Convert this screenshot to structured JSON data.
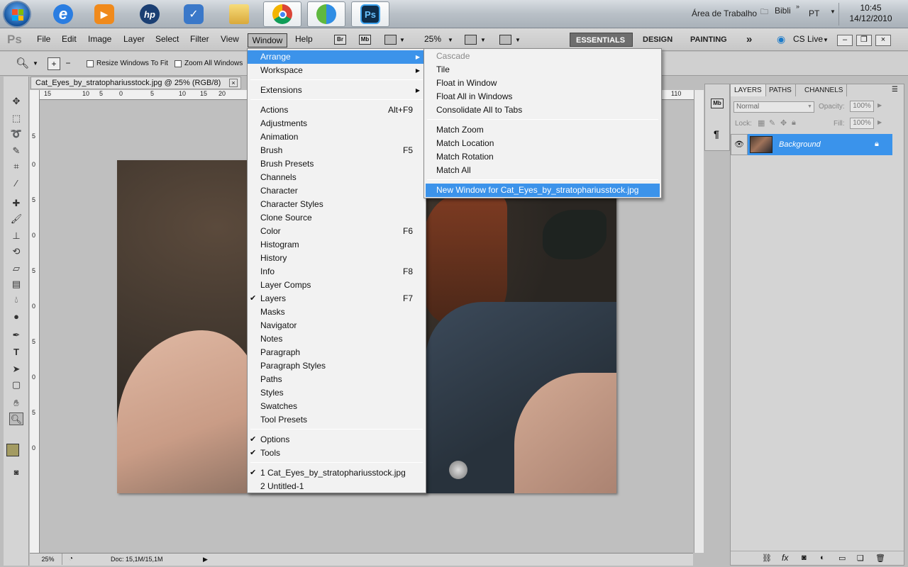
{
  "taskbar": {
    "apps": [
      {
        "name": "internet-explorer",
        "label": "e"
      },
      {
        "name": "media-player",
        "label": "▶"
      },
      {
        "name": "hp",
        "label": "hp"
      },
      {
        "name": "task",
        "label": "✓"
      },
      {
        "name": "explorer",
        "label": ""
      },
      {
        "name": "chrome",
        "label": ""
      },
      {
        "name": "messenger",
        "label": ""
      },
      {
        "name": "photoshop",
        "label": "Ps"
      }
    ],
    "desktop_label": "Área de Trabalho",
    "folder_label": "Bibli",
    "language": "PT",
    "time": "10:45",
    "date": "14/12/2010"
  },
  "menubar": {
    "logo": "Ps",
    "items": [
      "File",
      "Edit",
      "Image",
      "Layer",
      "Select",
      "Filter",
      "View",
      "Window",
      "Help"
    ],
    "active": "Window",
    "br_label": "Br",
    "mb_label": "Mb",
    "zoom": "25%",
    "workspaces": [
      "ESSENTIALS",
      "DESIGN",
      "PAINTING"
    ],
    "more": "»",
    "cslive": "CS Live"
  },
  "options": {
    "resize_label": "Resize Windows To Fit",
    "zoom_all_label": "Zoom All Windows"
  },
  "document": {
    "tab_title": "Cat_Eyes_by_stratophariusstock.jpg @ 25% (RGB/8)",
    "close": "×",
    "zoom": "25%",
    "doc_info": "Doc: 15,1M/15,1M",
    "ruler_h": [
      "15",
      "10",
      "5",
      "0",
      "5",
      "10",
      "15",
      "20",
      "110"
    ],
    "ruler_v": [
      "5",
      "0",
      "5",
      "0",
      "5",
      "0",
      "5",
      "0",
      "5",
      "0"
    ]
  },
  "window_menu": {
    "items": [
      {
        "label": "Arrange",
        "submenu": true,
        "highlight": true
      },
      {
        "label": "Workspace",
        "submenu": true
      },
      {
        "sep": true
      },
      {
        "label": "Extensions",
        "submenu": true
      },
      {
        "sep": true
      },
      {
        "label": "Actions",
        "shortcut": "Alt+F9"
      },
      {
        "label": "Adjustments"
      },
      {
        "label": "Animation"
      },
      {
        "label": "Brush",
        "shortcut": "F5"
      },
      {
        "label": "Brush Presets"
      },
      {
        "label": "Channels"
      },
      {
        "label": "Character"
      },
      {
        "label": "Character Styles"
      },
      {
        "label": "Clone Source"
      },
      {
        "label": "Color",
        "shortcut": "F6"
      },
      {
        "label": "Histogram"
      },
      {
        "label": "History"
      },
      {
        "label": "Info",
        "shortcut": "F8"
      },
      {
        "label": "Layer Comps"
      },
      {
        "label": "Layers",
        "shortcut": "F7",
        "checked": true
      },
      {
        "label": "Masks"
      },
      {
        "label": "Navigator"
      },
      {
        "label": "Notes"
      },
      {
        "label": "Paragraph"
      },
      {
        "label": "Paragraph Styles"
      },
      {
        "label": "Paths"
      },
      {
        "label": "Styles"
      },
      {
        "label": "Swatches"
      },
      {
        "label": "Tool Presets"
      },
      {
        "sep": true
      },
      {
        "label": "Options",
        "checked": true
      },
      {
        "label": "Tools",
        "checked": true
      },
      {
        "sep": true
      },
      {
        "label": "1 Cat_Eyes_by_stratophariusstock.jpg",
        "checked": true
      },
      {
        "label": "2 Untitled-1"
      }
    ]
  },
  "arrange_menu": {
    "items": [
      {
        "label": "Cascade",
        "disabled": true
      },
      {
        "label": "Tile"
      },
      {
        "label": "Float in Window"
      },
      {
        "label": "Float All in Windows"
      },
      {
        "label": "Consolidate All to Tabs"
      },
      {
        "sep": true
      },
      {
        "label": "Match Zoom"
      },
      {
        "label": "Match Location"
      },
      {
        "label": "Match Rotation"
      },
      {
        "label": "Match All"
      },
      {
        "sep": true
      },
      {
        "label": "New Window for Cat_Eyes_by_stratophariusstock.jpg",
        "highlight": true
      }
    ]
  },
  "layers_panel": {
    "tabs": [
      "LAYERS",
      "PATHS",
      "CHANNELS"
    ],
    "blend_mode": "Normal",
    "opacity_label": "Opacity:",
    "opacity": "100%",
    "lock_label": "Lock:",
    "fill_label": "Fill:",
    "fill": "100%",
    "layer_name": "Background",
    "mb_label": "Mb",
    "para_label": "¶"
  },
  "colors": {
    "accent": "#3c93ea",
    "foreground": "#a39b62"
  }
}
